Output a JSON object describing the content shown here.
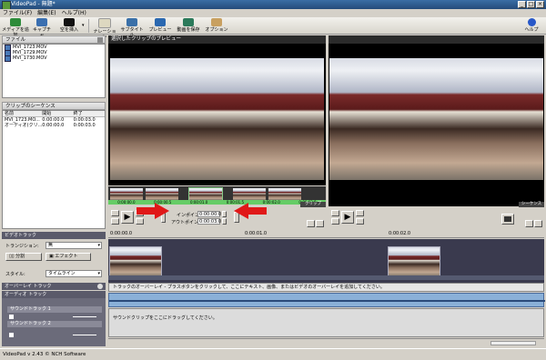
{
  "window": {
    "title": "VideoPad - 無題*"
  },
  "menu": [
    "ファイル(F)",
    "編集(E)",
    "ヘルプ(H)"
  ],
  "toolbar": [
    {
      "label": "メディアを追加",
      "icon": "add-media-icon",
      "color": "#2e8b3a"
    },
    {
      "label": "キャプチャ",
      "icon": "capture-icon",
      "color": "#3a6fb0"
    },
    {
      "label": "空を挿入",
      "icon": "blank-insert-icon",
      "color": "#111111"
    },
    {
      "label": "ナレーション",
      "icon": "narration-icon",
      "color": "#ddd8c0"
    },
    {
      "label": "サブタイトル",
      "icon": "subtitle-icon",
      "color": "#3a70a8"
    },
    {
      "label": "プレビュー",
      "icon": "preview-icon",
      "color": "#2a68b0"
    },
    {
      "label": "動画を保存",
      "icon": "save-video-icon",
      "color": "#2b7a5a"
    },
    {
      "label": "オプション",
      "icon": "options-icon",
      "color": "#c8a060"
    }
  ],
  "help_label": "ヘルプ",
  "files_panel": {
    "title": "ファイル",
    "files": [
      "MVI_1723.MOV",
      "MVI_1729.MOV",
      "MVI_1730.MOV"
    ]
  },
  "sequence_panel": {
    "title": "クリップのシーケンス",
    "headers": [
      "名前",
      "開始",
      "終了"
    ],
    "rows": [
      [
        "MVI_1723.MO...",
        "0:00:00.0",
        "0:00:03.0"
      ],
      [
        "オーディオ(クリ...",
        "0:00:00.0",
        "0:00:03.0"
      ]
    ]
  },
  "preview": {
    "title": "選択したクリップのプレビュー",
    "clip_label": "クリップ",
    "in_point_label": "インポイント",
    "out_point_label": "アウトポイント",
    "in_point": "0:00:00.0",
    "out_point": "0:00:03.0",
    "thumb_times": [
      "0:00:00.0",
      "0:00:00.5",
      "0:00:01.0",
      "0:00:01.5",
      "0:00:02.0",
      "0:00:02.5"
    ]
  },
  "sequence_preview": {
    "label": "シーケンス"
  },
  "effects": {
    "video_track_header": "ビデオトラック",
    "transition_label": "トランジション:",
    "transition_value": "無",
    "split_label": "分割",
    "effect_label": "エフェクト",
    "style_label": "スタイル:",
    "style_value": "タイムライン"
  },
  "overlay_header": "オーバーレイ トラック",
  "audio_header": "オーディオ トラック",
  "sound_tracks": [
    "サウンドトラック 1",
    "サウンドトラック 2"
  ],
  "timeline": {
    "ruler": [
      "0:00:00.0",
      "0:00:01.0",
      "0:00:02.0"
    ],
    "overlay_hint": "トラックのオーバーレイ - プラスボタンをクリックして、ここにテキスト、画像、またはビデオのオーバーレイを追加してください。",
    "sound_hint": "サウンドクリップをここにドラッグしてください。"
  },
  "status": "VideoPad v 2.43 © NCH Software"
}
